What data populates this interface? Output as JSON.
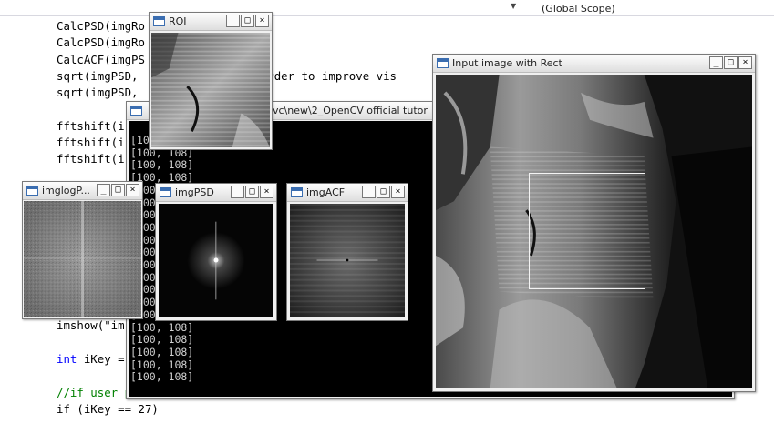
{
  "editor": {
    "scope_left": "",
    "scope_right": "(Global Scope)",
    "code_lines": [
      {
        "segments": [
          {
            "t": "CalcPSD(imgRo",
            "c": ""
          }
        ]
      },
      {
        "segments": [
          {
            "t": "CalcPSD(imgRo                e);",
            "c": ""
          }
        ]
      },
      {
        "segments": [
          {
            "t": "CalcACF(imgPS",
            "c": ""
          }
        ]
      },
      {
        "segments": [
          {
            "t": "sqrt(imgPSD,               in order to improve vis",
            "c": ""
          }
        ]
      },
      {
        "segments": [
          {
            "t": "sqrt(imgPSD,",
            "c": ""
          }
        ]
      },
      {
        "segments": [
          {
            "t": "",
            "c": ""
          }
        ]
      },
      {
        "segments": [
          {
            "t": "fftshift(i",
            "c": ""
          }
        ]
      },
      {
        "segments": [
          {
            "t": "fftshift(i",
            "c": ""
          }
        ]
      },
      {
        "segments": [
          {
            "t": "fftshift(i",
            "c": ""
          }
        ]
      },
      {
        "segments": [
          {
            "t": "",
            "c": ""
          }
        ]
      },
      {
        "segments": [
          {
            "t": "",
            "c": ""
          }
        ]
      },
      {
        "segments": [
          {
            "t": "",
            "c": ""
          }
        ]
      },
      {
        "segments": [
          {
            "t": "",
            "c": ""
          }
        ]
      },
      {
        "segments": [
          {
            "t": "",
            "c": ""
          }
        ]
      },
      {
        "segments": [
          {
            "t": "",
            "c": ""
          }
        ]
      },
      {
        "segments": [
          {
            "t": "",
            "c": ""
          }
        ]
      },
      {
        "segments": [
          {
            "t": "",
            "c": ""
          }
        ]
      },
      {
        "segments": [
          {
            "t": "imshow(\"im",
            "c": ""
          }
        ]
      },
      {
        "segments": [
          {
            "t": "imshow(\"im",
            "c": ""
          }
        ]
      },
      {
        "segments": [
          {
            "t": "",
            "c": ""
          }
        ]
      },
      {
        "segments": [
          {
            "t": "int",
            "c": "kw"
          },
          {
            "t": " iKey =",
            "c": ""
          }
        ]
      },
      {
        "segments": [
          {
            "t": "",
            "c": ""
          }
        ]
      },
      {
        "segments": [
          {
            "t": "//if user press 'ESC' key",
            "c": "cm"
          }
        ]
      },
      {
        "segments": [
          {
            "t": "if (iKey == 27)",
            "c": ""
          }
        ]
      }
    ]
  },
  "console": {
    "title": "vc\\new\\2_OpenCV official tutor",
    "lines": [
      "[100, 108]",
      "[100, 108]",
      "[100, 108]",
      "[100, 108]",
      "[100, 108]",
      "[100, 108]",
      "[100, 108]",
      "[100, 108]",
      "[100, 108]",
      "[100, 108]",
      "[100, 108]",
      "[100, 108]",
      "[100, 108]",
      "[100, 108]",
      "[100, 108]",
      "[100, 108]",
      "[100, 108]",
      "[100, 108]",
      "[100, 108]",
      "[100, 108]"
    ]
  },
  "windows": {
    "roi": {
      "title": "ROI"
    },
    "imglogpsd": {
      "title": "imglogP..."
    },
    "imgpsd": {
      "title": "imgPSD"
    },
    "imgacf": {
      "title": "imgACF"
    },
    "input": {
      "title": "Input image with Rect"
    }
  },
  "window_buttons": {
    "minimize": "_",
    "maximize": "□",
    "close": "×"
  },
  "icons": {
    "window": "window-icon",
    "dropdown": "dropdown-arrow-icon"
  }
}
